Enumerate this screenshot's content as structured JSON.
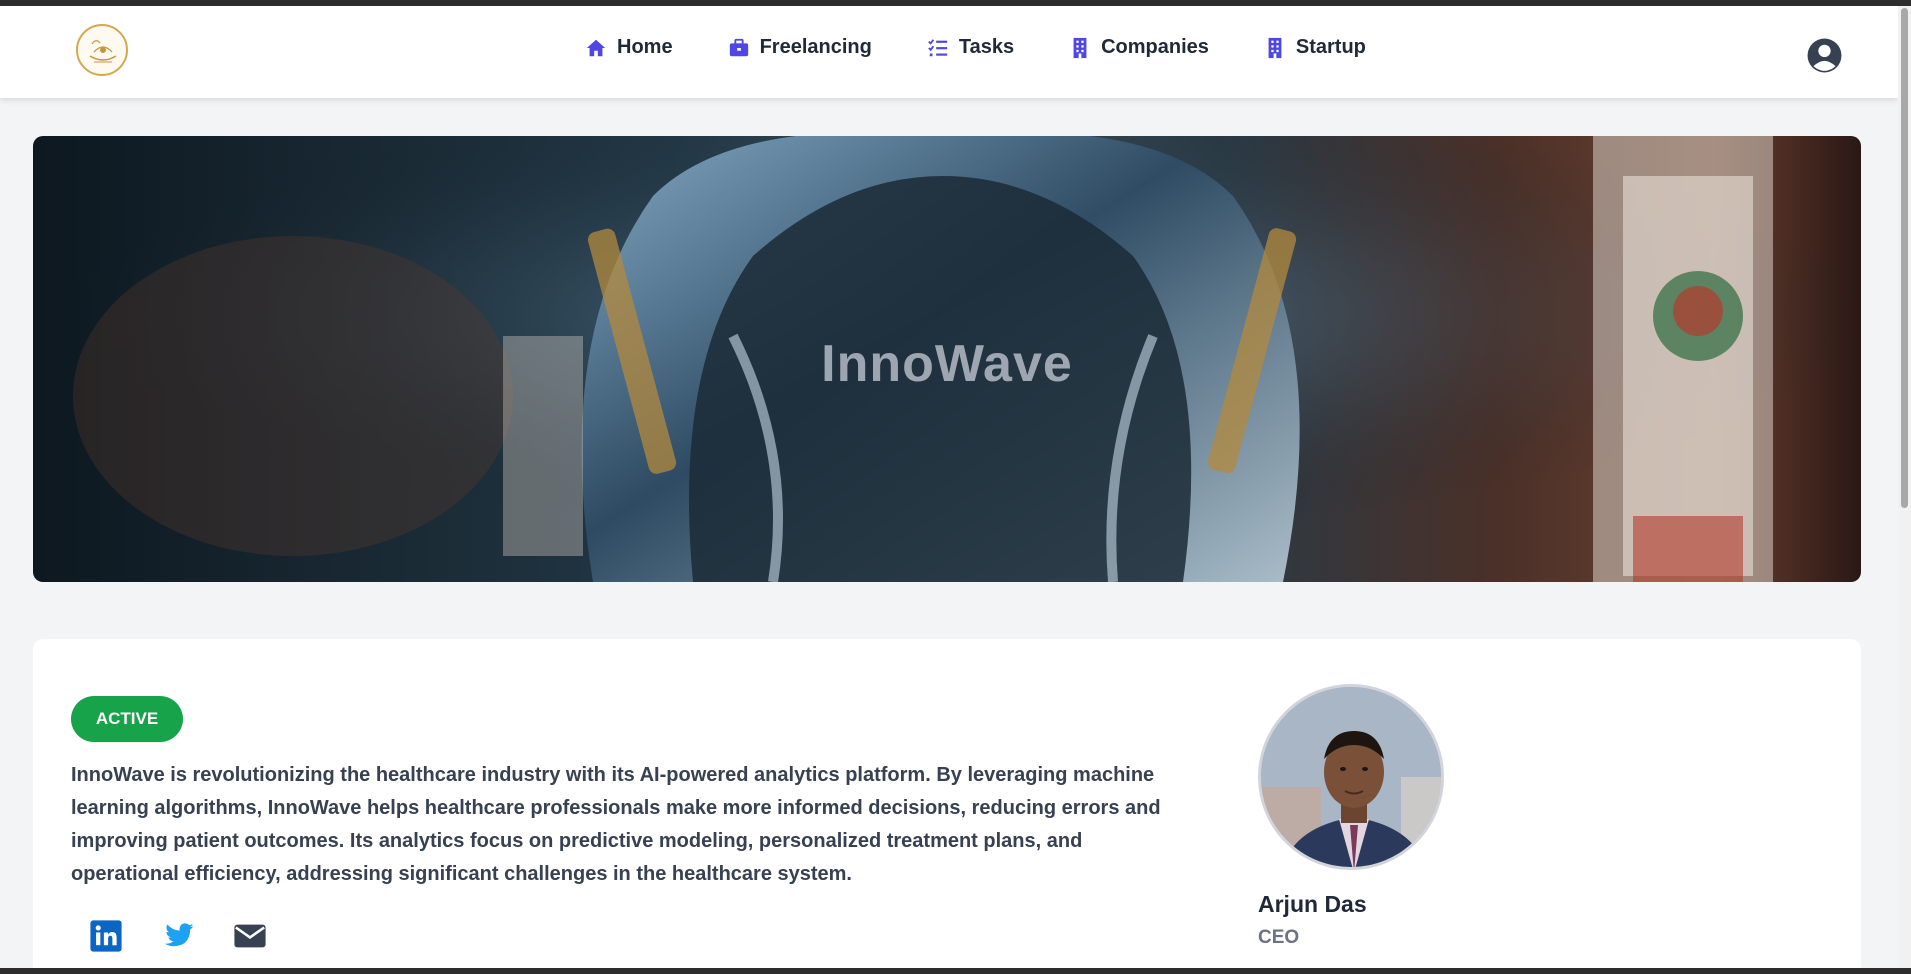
{
  "nav": {
    "items": [
      {
        "label": "Home",
        "icon": "home-icon"
      },
      {
        "label": "Freelancing",
        "icon": "briefcase-icon"
      },
      {
        "label": "Tasks",
        "icon": "list-check-icon"
      },
      {
        "label": "Companies",
        "icon": "building-icon"
      },
      {
        "label": "Startup",
        "icon": "building-icon"
      }
    ],
    "accent_color": "#4f46e5",
    "profile_icon": "user-circle-icon",
    "logo_icon": "logo-icon"
  },
  "banner": {
    "title": "InnoWave"
  },
  "company": {
    "status": "ACTIVE",
    "status_color": "#16a34a",
    "description": "InnoWave is revolutionizing the healthcare industry with its AI-powered analytics platform. By leveraging machine learning algorithms, InnoWave helps healthcare professionals make more informed decisions, reducing errors and improving patient outcomes. Its analytics focus on predictive modeling, personalized treatment plans, and operational efficiency, addressing significant challenges in the healthcare system.",
    "socials": [
      {
        "icon": "linkedin-icon",
        "color": "#0a66c2"
      },
      {
        "icon": "twitter-icon",
        "color": "#1da1f2"
      },
      {
        "icon": "mail-icon",
        "color": "#374151"
      }
    ]
  },
  "founder": {
    "name": "Arjun Das",
    "role": "CEO"
  }
}
